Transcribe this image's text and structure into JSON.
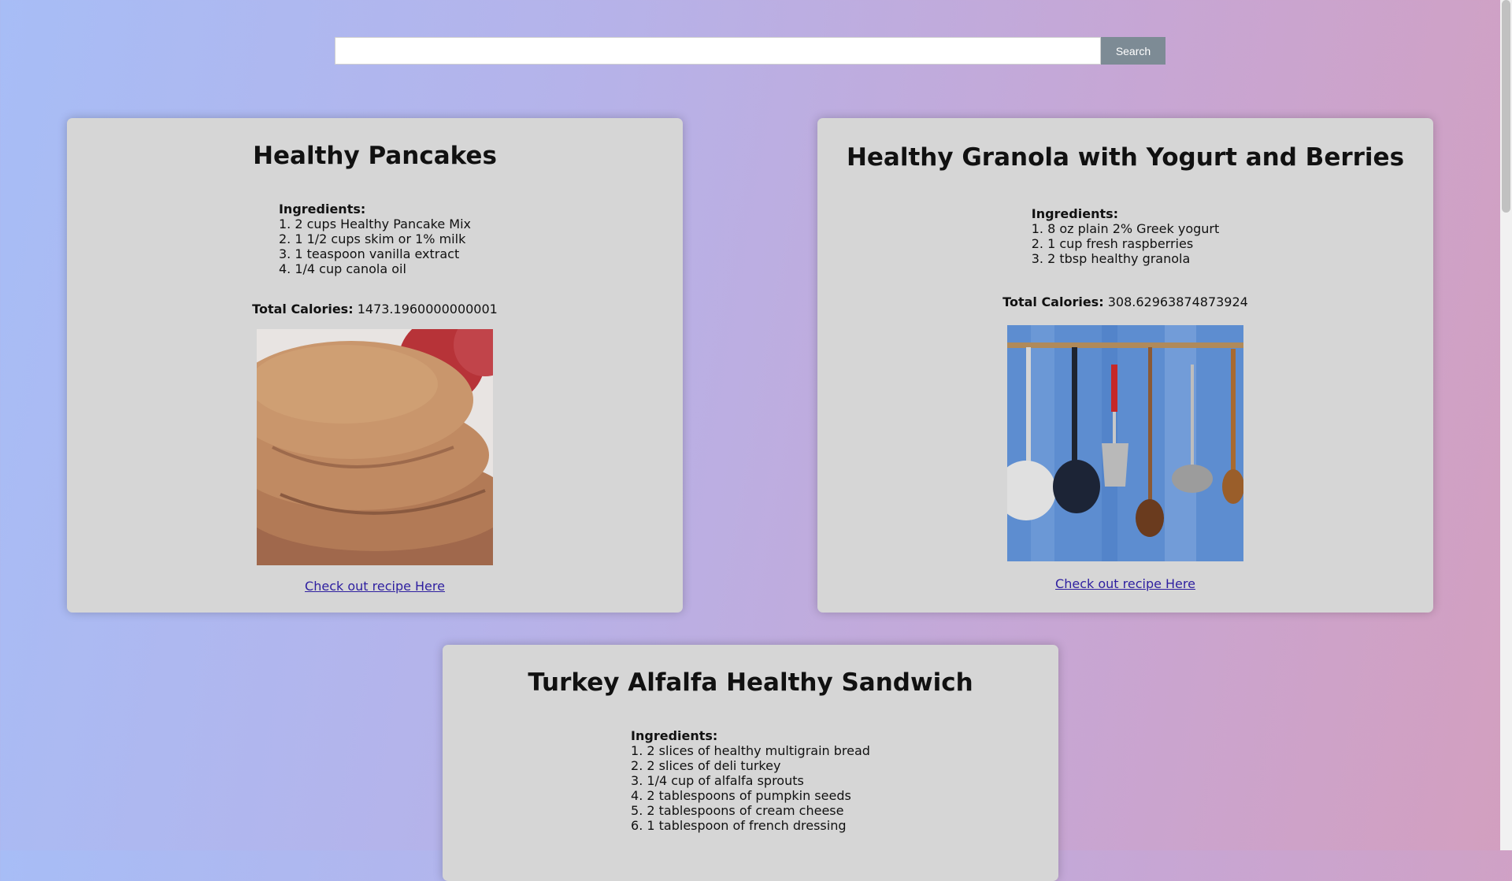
{
  "search": {
    "placeholder": "",
    "value": "",
    "button_label": "Search"
  },
  "recipes": [
    {
      "title": "Healthy Pancakes",
      "ingredients_label": "Ingredients:",
      "ingredients": [
        "2 cups Healthy Pancake Mix",
        "1 1/2 cups skim or 1% milk",
        "1 teaspoon vanilla extract",
        "1/4 cup canola oil"
      ],
      "calories_label": "Total Calories:",
      "calories_value": "1473.1960000000001",
      "link_label": "Check out recipe Here"
    },
    {
      "title": "Healthy Granola with Yogurt and Berries",
      "ingredients_label": "Ingredients:",
      "ingredients": [
        "8 oz plain 2% Greek yogurt",
        "1 cup fresh raspberries",
        "2 tbsp healthy granola"
      ],
      "calories_label": "Total Calories:",
      "calories_value": "308.62963874873924",
      "link_label": "Check out recipe Here"
    },
    {
      "title": "Turkey Alfalfa Healthy Sandwich",
      "ingredients_label": "Ingredients:",
      "ingredients": [
        "2 slices of healthy multigrain bread",
        "2 slices of deli turkey",
        "1/4 cup of alfalfa sprouts",
        "2 tablespoons of pumpkin seeds",
        "2 tablespoons of cream cheese",
        "1 tablespoon of french dressing"
      ]
    }
  ]
}
